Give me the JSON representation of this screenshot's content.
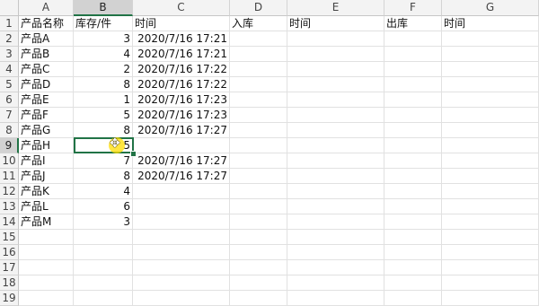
{
  "columns": [
    "A",
    "B",
    "C",
    "D",
    "E",
    "F",
    "G"
  ],
  "selected_column": "B",
  "selected_row": 9,
  "headers": {
    "product": "产品名称",
    "stock": "库存/件",
    "time1": "时间",
    "in": "入库",
    "time2": "时间",
    "out": "出库",
    "time3": "时间"
  },
  "rows": [
    {
      "n": "1"
    },
    {
      "n": "2",
      "a": "产品A",
      "b": "3",
      "c": "2020/7/16 17:21"
    },
    {
      "n": "3",
      "a": "产品B",
      "b": "4",
      "c": "2020/7/16 17:21"
    },
    {
      "n": "4",
      "a": "产品C",
      "b": "2",
      "c": "2020/7/16 17:22"
    },
    {
      "n": "5",
      "a": "产品D",
      "b": "8",
      "c": "2020/7/16 17:22"
    },
    {
      "n": "6",
      "a": "产品E",
      "b": "1",
      "c": "2020/7/16 17:23"
    },
    {
      "n": "7",
      "a": "产品F",
      "b": "5",
      "c": "2020/7/16 17:23"
    },
    {
      "n": "8",
      "a": "产品G",
      "b": "8",
      "c": "2020/7/16 17:27"
    },
    {
      "n": "9",
      "a": "产品H",
      "b": "5",
      "c": ""
    },
    {
      "n": "10",
      "a": "产品I",
      "b": "7",
      "c": "2020/7/16 17:27"
    },
    {
      "n": "11",
      "a": "产品J",
      "b": "8",
      "c": "2020/7/16 17:27"
    },
    {
      "n": "12",
      "a": "产品K",
      "b": "4",
      "c": ""
    },
    {
      "n": "13",
      "a": "产品L",
      "b": "6",
      "c": ""
    },
    {
      "n": "14",
      "a": "产品M",
      "b": "3",
      "c": ""
    },
    {
      "n": "15"
    },
    {
      "n": "16"
    },
    {
      "n": "17"
    },
    {
      "n": "18"
    },
    {
      "n": "19"
    }
  ],
  "cursor_icon": "cross-move-cursor-icon"
}
